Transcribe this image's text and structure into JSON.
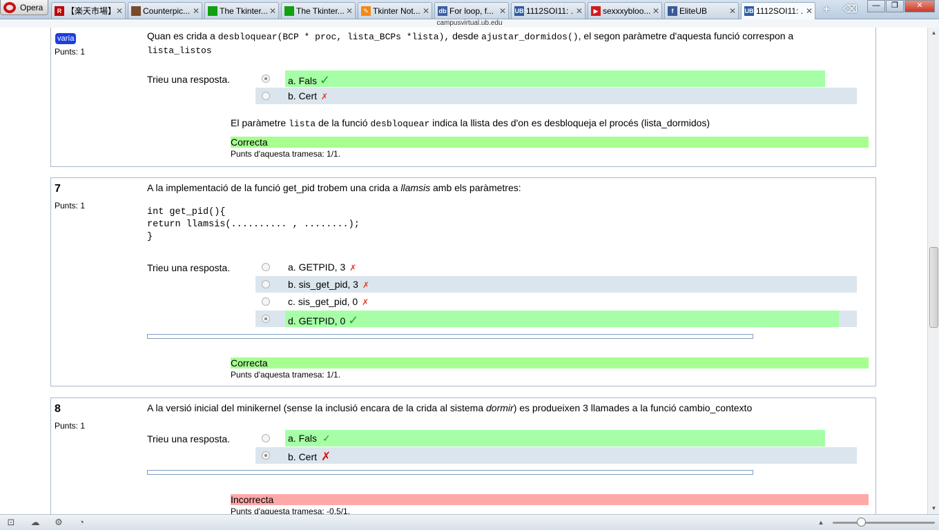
{
  "browser": {
    "menu_label": "Opera",
    "tabs": [
      {
        "title": "【楽天市場】...",
        "icon": "rakuten-icon",
        "color": "#bf0000",
        "glyph": "R"
      },
      {
        "title": "Counterpic...",
        "icon": "photo-icon",
        "color": "#7a4b2a",
        "glyph": ""
      },
      {
        "title": "The Tkinter...",
        "icon": "green-square-icon",
        "color": "#10a010",
        "glyph": ""
      },
      {
        "title": "The Tkinter...",
        "icon": "green-square-icon",
        "color": "#10a010",
        "glyph": ""
      },
      {
        "title": "Tkinter Not...",
        "icon": "tkinter-feather-icon",
        "color": "#f28a18",
        "glyph": "✎"
      },
      {
        "title": "For loop, f...",
        "icon": "db-icon",
        "color": "#3b5fa0",
        "glyph": "db"
      },
      {
        "title": "1112SOI11: ...",
        "icon": "ub-icon",
        "color": "#2d5aa0",
        "glyph": "UB"
      },
      {
        "title": "sexxxybloo...",
        "icon": "youtube-icon",
        "color": "#d21b1b",
        "glyph": "▶"
      },
      {
        "title": "EliteUB",
        "icon": "facebook-icon",
        "color": "#3b5998",
        "glyph": "f"
      },
      {
        "title": "1112SOI11: ...",
        "icon": "ub-icon",
        "color": "#2d5aa0",
        "glyph": "UB"
      }
    ],
    "url": "campusvirtual.ub.edu",
    "status_icons": [
      "panel-toggle-icon",
      "opera-unite-icon",
      "turbo-icon",
      "speed-dial-icon"
    ]
  },
  "q6": {
    "badge": "varía",
    "points_label": "Punts: 1",
    "text_pre": "Quan es crida a ",
    "code1": "desbloquear(BCP * proc, lista_BCPs *lista),",
    "text_mid": " desde ",
    "code2": "ajustar_dormidos()",
    "text_post": ", el segon paràmetre d'aquesta funció correspon a",
    "code3": "lista_listos",
    "prompt": "Trieu una resposta.",
    "options": [
      {
        "label": "a. Fals",
        "mark": "✓"
      },
      {
        "label": "b. Cert",
        "mark": "✗"
      }
    ],
    "feedback": {
      "pre": "El paràmetre ",
      "code1": "lista",
      "mid": " de la funció ",
      "code2": "desbloquear",
      "post": " indica la llista des d'on es desbloqueja el procés (lista_dormidos)"
    },
    "grade": "Correcta",
    "points": "Punts d'aquesta tramesa: 1/1."
  },
  "q7": {
    "number": "7",
    "points_label": "Punts: 1",
    "text_pre": "A la implementació de la funció get_pid trobem una crida a ",
    "text_em": "llamsis",
    "text_post": " amb els paràmetres:",
    "code_lines": [
      "int get_pid(){",
      "return llamsis(.......... , ........);",
      "}"
    ],
    "prompt": "Trieu una resposta.",
    "options": [
      {
        "label": "a. GETPID, 3",
        "mark": "✗"
      },
      {
        "label": "b. sis_get_pid, 3",
        "mark": "✗"
      },
      {
        "label": "c. sis_get_pid, 0",
        "mark": "✗"
      },
      {
        "label": "d. GETPID, 0",
        "mark": "✓"
      }
    ],
    "grade": "Correcta",
    "points": "Punts d'aquesta tramesa: 1/1."
  },
  "q8": {
    "number": "8",
    "points_label": "Punts: 1",
    "text_pre": "A la versió inicial del minikernel (sense la inclusió encara de la crida al sistema ",
    "text_em": "dormir",
    "text_post": ") es produeixen 3 llamades a la funció cambio_contexto",
    "prompt": "Trieu una resposta.",
    "options": [
      {
        "label": "a. Fals",
        "mark": "✓"
      },
      {
        "label": "b. Cert",
        "mark": "✗"
      }
    ],
    "grade": "Incorrecta",
    "points": "Punts d'aquesta tramesa: -0.5/1."
  },
  "colors": {
    "correct_bg": "#a6ff8f",
    "incorrect_bg": "#ffa8a8",
    "selected_option_bg": "#a6ffa6",
    "alt_row_bg": "#dbe5ed",
    "badge_bg": "#1c3fdf"
  }
}
